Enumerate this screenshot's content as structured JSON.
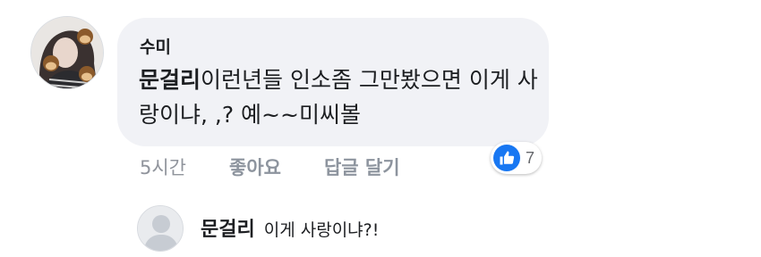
{
  "comment": {
    "author": "수미",
    "mention": "문걸리",
    "text_rest": "이런년들 인소좀 그만봤으면 이게 사랑이냐, ,? 예~~미씨볼",
    "time": "5시간",
    "like_label": "좋아요",
    "reply_label": "답글 달기",
    "reaction": {
      "icon": "thumbs-up-icon",
      "count": "7",
      "color": "#1877f2"
    }
  },
  "reply": {
    "author": "문걸리",
    "text": "이게 사랑이냐?!",
    "avatar_icon": "default-user-avatar-icon"
  }
}
